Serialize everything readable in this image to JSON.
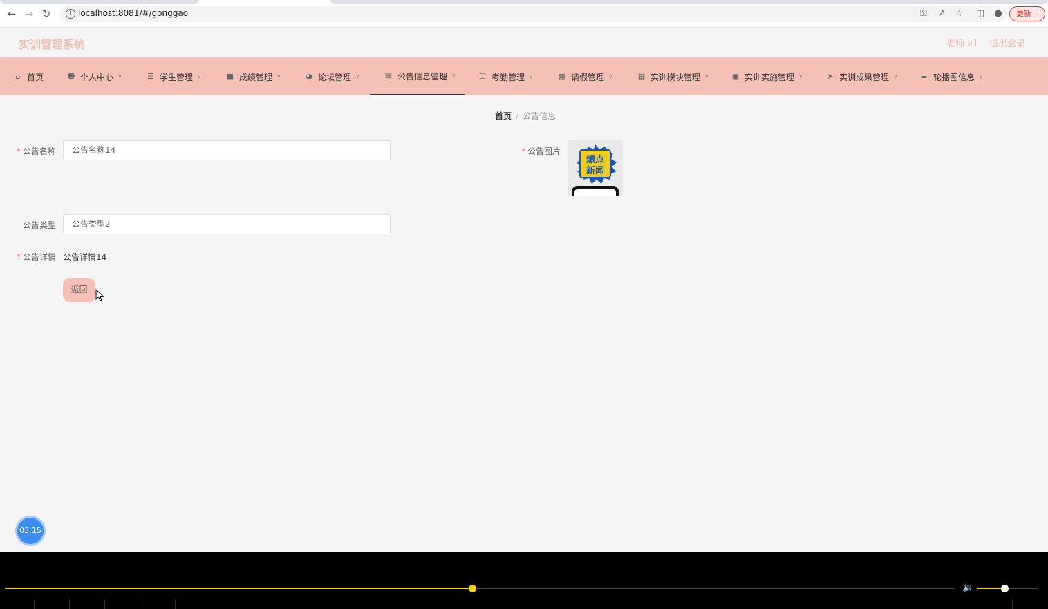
{
  "browser": {
    "url": "localhost:8081/#/gonggao",
    "update_label": "更新",
    "icons": [
      "back-arrow-icon",
      "forward-arrow-icon",
      "reload-icon",
      "info-icon",
      "key-icon",
      "share-icon",
      "star-icon",
      "sidebar-icon",
      "profile-icon",
      "more-icon"
    ]
  },
  "header": {
    "title": "实训管理系统",
    "user": "老师 a1",
    "logout": "退出登录"
  },
  "menu": [
    {
      "label": "首页",
      "icon": "home-icon",
      "has_children": false
    },
    {
      "label": "个人中心",
      "icon": "user-icon",
      "has_children": true
    },
    {
      "label": "学生管理",
      "icon": "list-icon",
      "has_children": true
    },
    {
      "label": "成绩管理",
      "icon": "book-icon",
      "has_children": true
    },
    {
      "label": "论坛管理",
      "icon": "compass-icon",
      "has_children": true
    },
    {
      "label": "公告信息管理",
      "icon": "clipboard-icon",
      "has_children": true,
      "active": true
    },
    {
      "label": "考勤管理",
      "icon": "check-clipboard-icon",
      "has_children": true
    },
    {
      "label": "请假管理",
      "icon": "briefcase-icon",
      "has_children": true
    },
    {
      "label": "实训模块管理",
      "icon": "grid-icon",
      "has_children": true
    },
    {
      "label": "实训实施管理",
      "icon": "suitcase-icon",
      "has_children": true
    },
    {
      "label": "实训成果管理",
      "icon": "send-icon",
      "has_children": true
    },
    {
      "label": "轮播图信息",
      "icon": "menu-icon",
      "has_children": true
    }
  ],
  "breadcrumb": {
    "home": "首页",
    "separator": "/",
    "current": "公告信息"
  },
  "form": {
    "name_label": "公告名称",
    "name_value": "公告名称14",
    "image_label": "公告图片",
    "image_text_line1": "爆点",
    "image_text_line2": "新闻",
    "type_label": "公告类型",
    "type_value": "公告类型2",
    "detail_label": "公告详情",
    "detail_value": "公告详情14",
    "back_button": "返回"
  },
  "timer": "03:15",
  "player": {
    "progress": 0.493,
    "volume": 0.45
  },
  "colors": {
    "accent": "#f5c1b6",
    "title": "#f2bdb2",
    "required": "#f56c6c",
    "timer": "#3b8ef0",
    "player_progress": "#f2d200"
  }
}
